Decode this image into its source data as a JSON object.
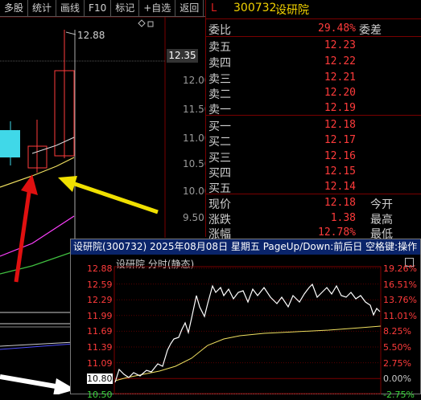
{
  "toolbar": {
    "buttons": [
      "多股",
      "统计",
      "画线",
      "F10",
      "标记",
      "+自选",
      "返回"
    ]
  },
  "kline": {
    "high_label": "12.88",
    "current_price_tag": "12.35",
    "y_ticks": [
      "12.00",
      "11.50",
      "11.00",
      "10.50",
      "10.00",
      "9.50"
    ]
  },
  "quote": {
    "flag": "L",
    "code": "300732",
    "name": "设研院",
    "weibi_label": "委比",
    "weibi_value": "29.48%",
    "weicha_label": "委差",
    "sell": [
      {
        "label": "卖五",
        "price": "12.23"
      },
      {
        "label": "卖四",
        "price": "12.22"
      },
      {
        "label": "卖三",
        "price": "12.21"
      },
      {
        "label": "卖二",
        "price": "12.20"
      },
      {
        "label": "卖一",
        "price": "12.19"
      }
    ],
    "buy": [
      {
        "label": "买一",
        "price": "12.18"
      },
      {
        "label": "买二",
        "price": "12.17"
      },
      {
        "label": "买三",
        "price": "12.16"
      },
      {
        "label": "买四",
        "price": "12.15"
      },
      {
        "label": "买五",
        "price": "12.14"
      }
    ],
    "stats": [
      {
        "label": "现价",
        "value": "12.18",
        "label2": "今开"
      },
      {
        "label": "涨跌",
        "value": "1.38",
        "label2": "最高"
      },
      {
        "label": "涨幅",
        "value": "12.78%",
        "label2": "最低"
      }
    ]
  },
  "popup": {
    "title": "设研院(300732) 2025年08月08日 星期五 PageUp/Down:前后日 空格键:操作",
    "subtitle": "设研院  分时(静态)",
    "left_axis": [
      "12.88",
      "12.59",
      "12.29",
      "11.99",
      "11.69",
      "11.39",
      "11.09",
      "10.80",
      "10.50"
    ],
    "right_axis": [
      "19.26%",
      "16.51%",
      "13.76%",
      "11.01%",
      "8.25%",
      "5.50%",
      "2.75%",
      "0.00%",
      "-2.75%"
    ],
    "colors": {
      "price_line": "#ffffff",
      "avg_line": "#f0e060",
      "up": "#ff3b3b",
      "zero": "#c8c8c8",
      "down": "#3bd63b"
    }
  }
}
